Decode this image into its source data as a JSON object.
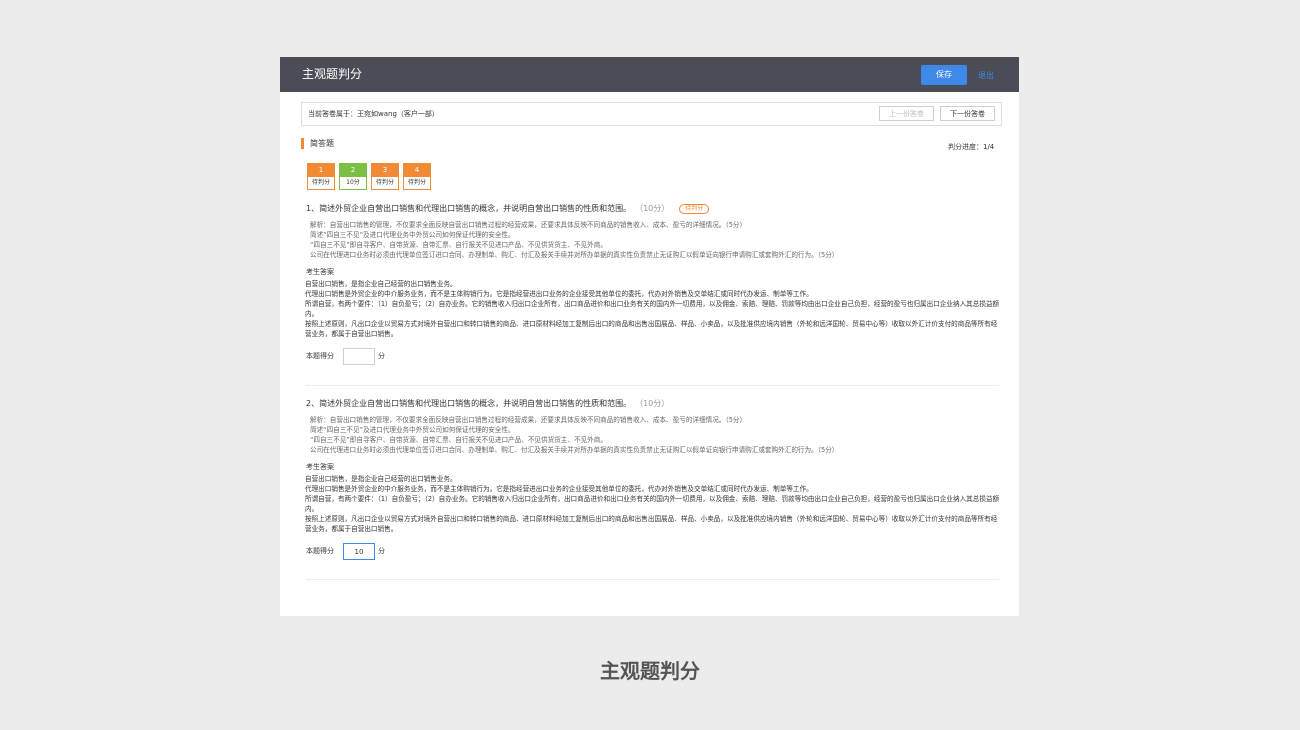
{
  "header": {
    "title": "主观题判分",
    "save_label": "保存",
    "exit_label": "退出"
  },
  "owner_bar": {
    "text": "当前答卷属于：王宛如wang（客户一部）",
    "prev_label": "上一份答卷",
    "next_label": "下一份答卷"
  },
  "section": {
    "title": "简答题",
    "progress": "判分进度：1/4"
  },
  "question_nav": [
    {
      "num": "1",
      "status": "待判分",
      "color": "orange"
    },
    {
      "num": "2",
      "status": "10分",
      "color": "green"
    },
    {
      "num": "3",
      "status": "待判分",
      "color": "orange"
    },
    {
      "num": "4",
      "status": "待判分",
      "color": "orange"
    }
  ],
  "questions": [
    {
      "title": "1、简述外贸企业自营出口销售和代理出口销售的概念，并说明自营出口销售的性质和范围。",
      "score": "（10分）",
      "badge": "待判分",
      "analysis": [
        "解析：自营出口销售的管理，不仅要求全面反映自营出口销售过程的经营成果，还要求具体反映不同商品的销售收入、成本、盈亏的详细情况。（5分）",
        "简述“四自三不见”及进口代理业务中外贸公司如何保证代理的安全性。",
        "“四自三不见”即自寻客户、自带货源、自带汇票、自行报关不见进口产品、不见供货货主、不见外商。",
        "公司在代理进口业务时必须由代理单位签订进口合同、办理制单、购汇、付汇及报关手续并对所办单据的真实性负责禁止无证购汇以假单证向银行申请购汇或套购外汇的行为。（5分）"
      ],
      "answer_label": "考生答案",
      "answer": [
        "自营出口销售，是指企业自己经营的出口销售业务。",
        "代理出口销售是外贸企业的中介服务业务，而不是主体购销行为。它是指经营进出口业务的企业接受其他单位的委托，代办对外销售及交单结汇或同时代办发运、制单等工作。",
        "所谓自营，有两个要件：（1）自负盈亏；（2）自办业务。它的销售收入归出口企业所有，出口商品进价和出口业务有关的国内外一切费用，以及佣金、索赔、理赔、罚款等均由出口企业自己负担，经营的盈亏也归属出口企业纳入其总损益额内。",
        "按照上述原则，凡出口企业以贸易方式对境外自营出口和转口销售的商品、进口原材料经加工复制后出口的商品和出售出国展品、样品、小卖品，以及批准供应境内销售（外轮和远洋国轮、贸易中心等）收取以外汇计价支付的商品等所有经营业务，都属于自营出口销售。"
      ],
      "score_label": "本题得分",
      "score_value": "",
      "unit": "分"
    },
    {
      "title": "2、简述外贸企业自营出口销售和代理出口销售的概念，并说明自营出口销售的性质和范围。",
      "score": "（10分）",
      "badge": "",
      "analysis": [
        "解析：自营出口销售的管理，不仅要求全面反映自营出口销售过程的经营成果，还要求具体反映不同商品的销售收入、成本、盈亏的详细情况。（5分）",
        "简述“四自三不见”及进口代理业务中外贸公司如何保证代理的安全性。",
        "“四自三不见”即自寻客户、自带货源、自带汇票、自行报关不见进口产品、不见供货货主、不见外商。",
        "公司在代理进口业务时必须由代理单位签订进口合同、办理制单、购汇、付汇及报关手续并对所办单据的真实性负责禁止无证购汇以假单证向银行申请购汇或套购外汇的行为。（5分）"
      ],
      "answer_label": "考生答案",
      "answer": [
        "自营出口销售，是指企业自己经营的出口销售业务。",
        "代理出口销售是外贸企业的中介服务业务，而不是主体购销行为。它是指经营进出口业务的企业接受其他单位的委托，代办对外销售及交单结汇或同时代办发运、制单等工作。",
        "所谓自营，有两个要件：（1）自负盈亏；（2）自办业务。它的销售收入归出口企业所有，出口商品进价和出口业务有关的国内外一切费用，以及佣金、索赔、理赔、罚款等均由出口企业自己负担，经营的盈亏也归属出口企业纳入其总损益额内。",
        "按照上述原则，凡出口企业以贸易方式对境外自营出口和转口销售的商品、进口原材料经加工复制后出口的商品和出售出国展品、样品、小卖品，以及批准供应境内销售（外轮和远洋国轮、贸易中心等）收取以外汇计价支付的商品等所有经营业务，都属于自营出口销售。"
      ],
      "score_label": "本题得分",
      "score_value": "10",
      "unit": "分"
    }
  ],
  "caption": "主观题判分",
  "colors": {
    "accent_blue": "#3d88e8",
    "orange": "#f08a35",
    "green": "#7bc043",
    "topbar": "#4a4d55"
  }
}
